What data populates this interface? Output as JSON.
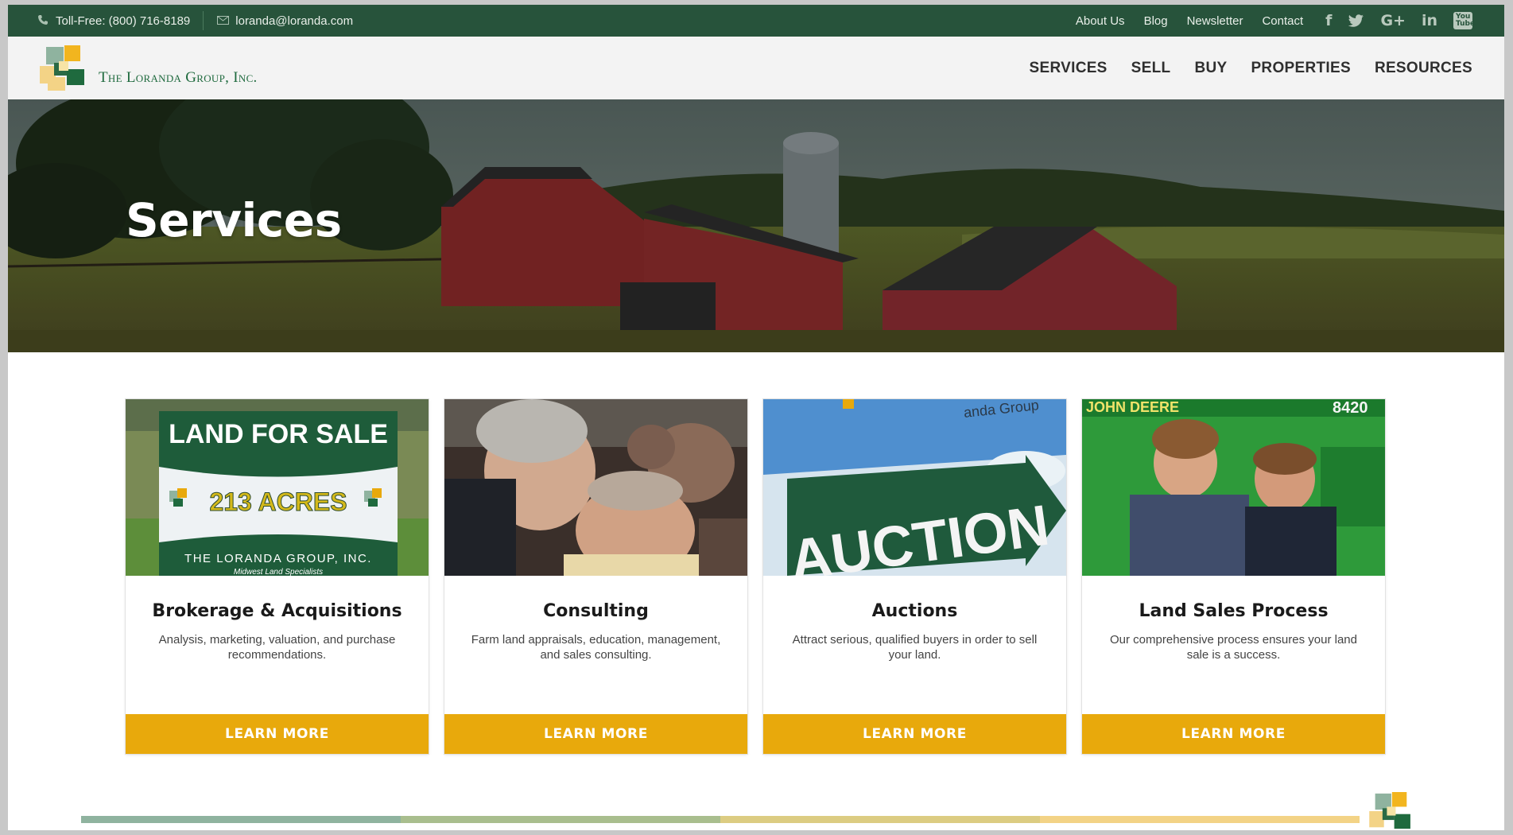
{
  "topbar": {
    "phone": "Toll-Free: (800) 716-8189",
    "email": "loranda@loranda.com",
    "links": [
      "About Us",
      "Blog",
      "Newsletter",
      "Contact"
    ],
    "social": [
      "facebook-icon",
      "twitter-icon",
      "google-plus-icon",
      "linkedin-icon",
      "youtube-icon"
    ],
    "social_labels": {
      "facebook": "f",
      "googleplus": "G+",
      "linkedin": "in",
      "youtube": "You Tube"
    }
  },
  "header": {
    "logo_text": "The Loranda Group, Inc.",
    "nav": [
      "SERVICES",
      "SELL",
      "BUY",
      "PROPERTIES",
      "RESOURCES"
    ]
  },
  "hero": {
    "title": "Services"
  },
  "cards": [
    {
      "title": "Brokerage & Acquisitions",
      "description": "Analysis, marketing, valuation, and purchase recommendations.",
      "button": "LEARN MORE",
      "image_text": {
        "line1": "LAND FOR SALE",
        "line2": "213 ACRES",
        "line3": "THE LORANDA GROUP, INC.",
        "line4": "Midwest Land Specialists"
      }
    },
    {
      "title": "Consulting",
      "description": "Farm land appraisals, education, management, and sales consulting.",
      "button": "LEARN MORE"
    },
    {
      "title": "Auctions",
      "description": "Attract serious, qualified buyers in order to sell your land.",
      "button": "LEARN MORE",
      "image_text": {
        "sign": "AUCTION",
        "top": "anda Group"
      }
    },
    {
      "title": "Land Sales Process",
      "description": "Our comprehensive process ensures your land sale is a success.",
      "button": "LEARN MORE",
      "image_text": {
        "brand": "JOHN DEERE",
        "model": "8420"
      }
    }
  ],
  "colors": {
    "topbar": "#27533b",
    "header_bg": "#f3f3f3",
    "button": "#e8a90c",
    "logo_green": "#1f6a3e",
    "stripe": [
      "#8fb39f",
      "#a9be8e",
      "#dccc82",
      "#f3d386"
    ]
  }
}
